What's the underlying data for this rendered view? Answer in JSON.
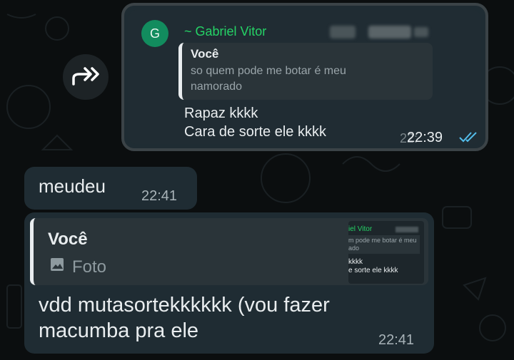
{
  "forwarded_screenshot": {
    "avatar_letter": "G",
    "sender_name": "~ Gabriel Vitor",
    "quote_author": "Você",
    "quote_text_line1": "so quem pode me botar é meu",
    "quote_text_line2": "namorado",
    "body_line1": "Rapaz kkkk",
    "body_line2": "Cara de sorte ele kkkk",
    "time": "22:39",
    "time_shadow": "22:",
    "status_icon": "double-check-icon"
  },
  "incoming_message": {
    "text": "meudeu",
    "time": "22:41"
  },
  "reply_message": {
    "quote_author": "Você",
    "quote_kind": "Foto",
    "quote_kind_icon": "image-icon",
    "thumb": {
      "name": "iel Vitor",
      "quote_line1": "m pode me botar é meu",
      "quote_line2": "ado",
      "body_line1": "kkkk",
      "body_line2": "e sorte ele kkkk"
    },
    "text": "vdd mutasortekkkkkk (vou fazer macumba pra ele",
    "time": "22:41"
  },
  "colors": {
    "background": "#0b0e0f",
    "bubble": "#1f2c33",
    "quote_bg": "#2a3439",
    "accent_green": "#25d366",
    "tick_blue": "#53bdeb"
  }
}
